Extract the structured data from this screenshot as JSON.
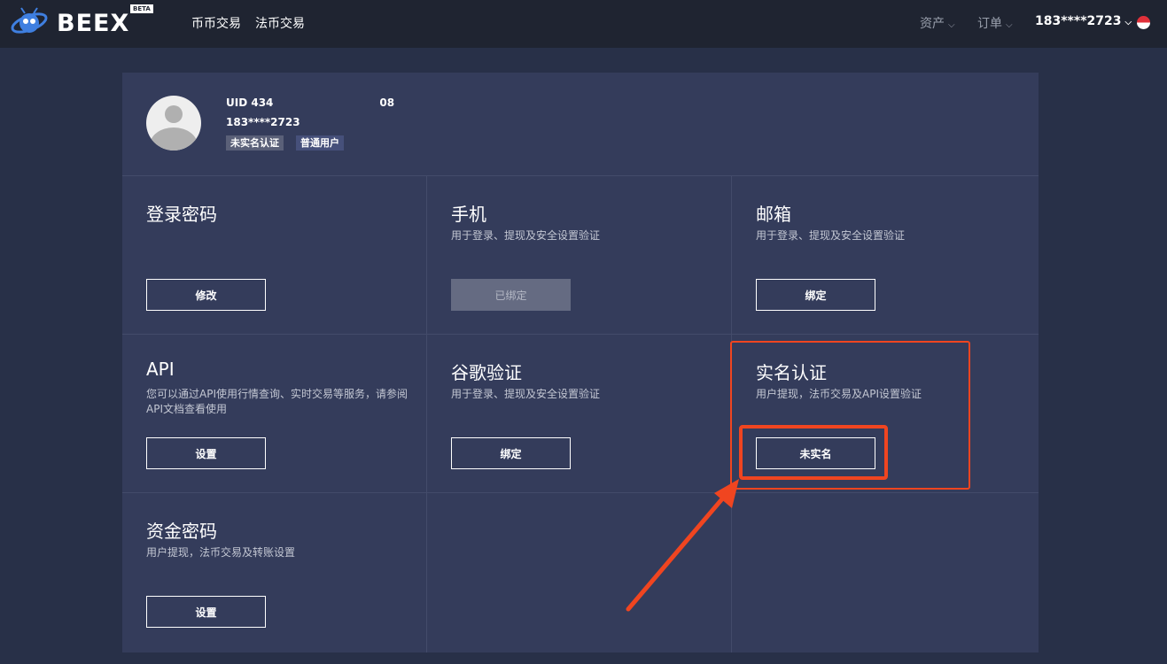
{
  "header": {
    "logo_text": "BEEX",
    "beta_badge": "BETA",
    "nav": [
      "币币交易",
      "法币交易"
    ],
    "assets_label": "资产",
    "orders_label": "订单",
    "user_label": "183****2723",
    "chevron": "⌵",
    "language_flag_icon": "flag-icon"
  },
  "profile": {
    "uid_prefix": "UID 434",
    "uid_suffix": "08",
    "phone": "183****2723",
    "tags": [
      "未实名认证",
      "普通用户"
    ]
  },
  "cells": [
    {
      "title": "登录密码",
      "desc": "",
      "button": "修改",
      "disabled": false
    },
    {
      "title": "手机",
      "desc": "用于登录、提现及安全设置验证",
      "button": "已绑定",
      "disabled": true
    },
    {
      "title": "邮箱",
      "desc": "用于登录、提现及安全设置验证",
      "button": "绑定",
      "disabled": false
    },
    {
      "title": "API",
      "desc": "您可以通过API使用行情查询、实时交易等服务，请参阅API文档查看使用",
      "button": "设置",
      "disabled": false
    },
    {
      "title": "谷歌验证",
      "desc": "用于登录、提现及安全设置验证",
      "button": "绑定",
      "disabled": false
    },
    {
      "title": "实名认证",
      "desc": "用户提现，法币交易及API设置验证",
      "button": "未实名",
      "disabled": false
    },
    {
      "title": "资金密码",
      "desc": "用户提现，法币交易及转账设置",
      "button": "设置",
      "disabled": false
    }
  ],
  "colors": {
    "background": "#283048",
    "topbar": "#1f2431",
    "panel": "#343c5b",
    "annotation": "#f04520"
  }
}
